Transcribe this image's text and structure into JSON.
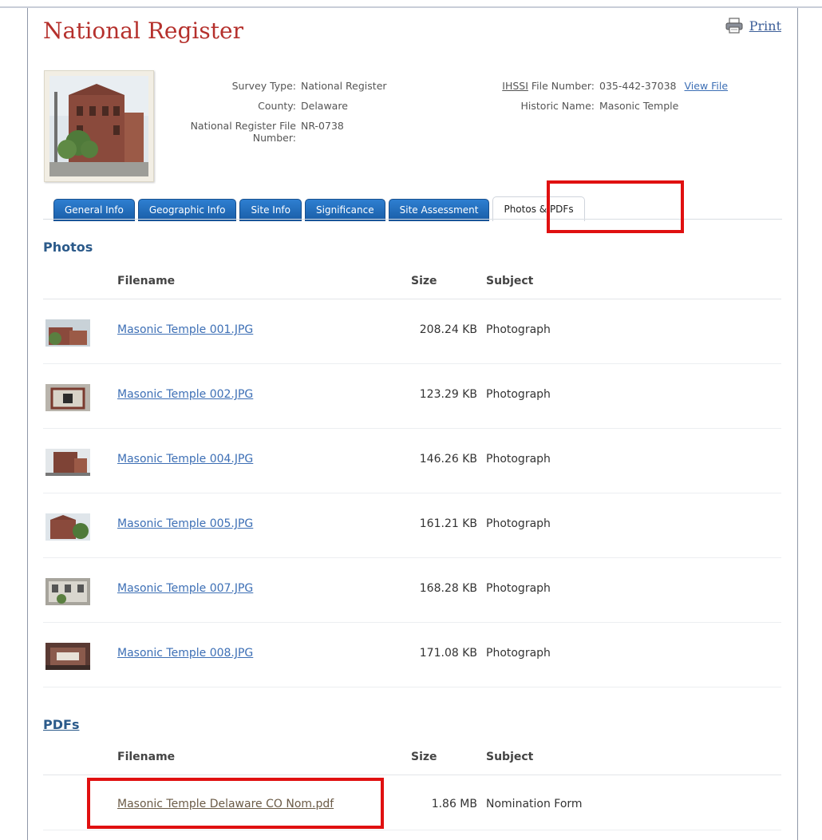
{
  "page": {
    "title": "National Register",
    "print_label": "Print"
  },
  "info": {
    "survey_type_label": "Survey Type:",
    "survey_type_value": "National Register",
    "county_label": "County:",
    "county_value": "Delaware",
    "nr_file_label": "National Register File Number:",
    "nr_file_value": "NR-0738",
    "ihssi_abbr": "IHSSI",
    "ihssi_label_rest": " File Number:",
    "ihssi_value": "035-442-37038",
    "view_file_label": "View File",
    "historic_name_label": "Historic Name:",
    "historic_name_value": "Masonic Temple"
  },
  "tabs": [
    {
      "label": "General Info",
      "active": false
    },
    {
      "label": "Geographic Info",
      "active": false
    },
    {
      "label": "Site Info",
      "active": false
    },
    {
      "label": "Significance",
      "active": false
    },
    {
      "label": "Site Assessment",
      "active": false
    },
    {
      "label": "Photos & PDFs",
      "active": true
    }
  ],
  "photos": {
    "title": "Photos",
    "headers": {
      "filename": "Filename",
      "size": "Size",
      "subject": "Subject"
    },
    "rows": [
      {
        "filename": "Masonic Temple 001.JPG",
        "size": "208.24 KB",
        "subject": "Photograph"
      },
      {
        "filename": "Masonic Temple 002.JPG",
        "size": "123.29 KB",
        "subject": "Photograph"
      },
      {
        "filename": "Masonic Temple 004.JPG",
        "size": "146.26 KB",
        "subject": "Photograph"
      },
      {
        "filename": "Masonic Temple 005.JPG",
        "size": "161.21 KB",
        "subject": "Photograph"
      },
      {
        "filename": "Masonic Temple 007.JPG",
        "size": "168.28 KB",
        "subject": "Photograph"
      },
      {
        "filename": "Masonic Temple 008.JPG",
        "size": "171.08 KB",
        "subject": "Photograph"
      }
    ]
  },
  "pdfs": {
    "title": "PDFs",
    "headers": {
      "filename": "Filename",
      "size": "Size",
      "subject": "Subject"
    },
    "rows": [
      {
        "filename": "Masonic Temple Delaware CO Nom.pdf",
        "size": "1.86 MB",
        "subject": "Nomination Form"
      }
    ]
  },
  "colors": {
    "title": "#b5302c",
    "tab_blue": "#1a5ea8",
    "link": "#3d6fb5",
    "annotation_red": "#e01010"
  },
  "icons": [
    "printer-icon"
  ]
}
